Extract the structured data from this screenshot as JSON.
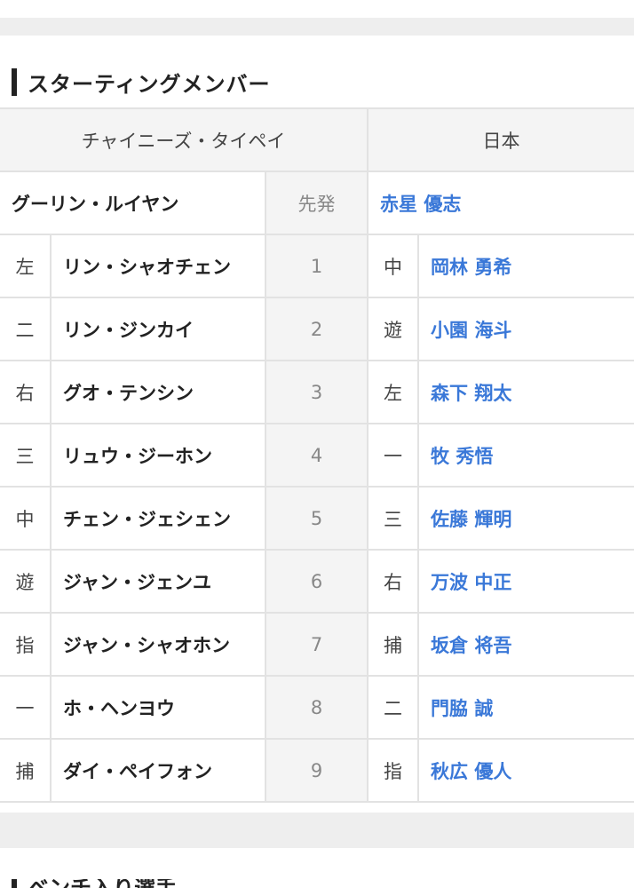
{
  "section": {
    "title": "スターティングメンバー"
  },
  "teams": {
    "away": "チャイニーズ・タイペイ",
    "home": "日本"
  },
  "starter": {
    "label": "先発",
    "away": "グーリン・ルイヤン",
    "home": "赤星 優志"
  },
  "lineup": [
    {
      "order": "1",
      "away_pos": "左",
      "away_name": "リン・シャオチェン",
      "home_pos": "中",
      "home_name": "岡林 勇希"
    },
    {
      "order": "2",
      "away_pos": "二",
      "away_name": "リン・ジンカイ",
      "home_pos": "遊",
      "home_name": "小園 海斗"
    },
    {
      "order": "3",
      "away_pos": "右",
      "away_name": "グオ・テンシン",
      "home_pos": "左",
      "home_name": "森下 翔太"
    },
    {
      "order": "4",
      "away_pos": "三",
      "away_name": "リュウ・ジーホン",
      "home_pos": "一",
      "home_name": "牧 秀悟"
    },
    {
      "order": "5",
      "away_pos": "中",
      "away_name": "チェン・ジェシェン",
      "home_pos": "三",
      "home_name": "佐藤 輝明"
    },
    {
      "order": "6",
      "away_pos": "遊",
      "away_name": "ジャン・ジェンユ",
      "home_pos": "右",
      "home_name": "万波 中正"
    },
    {
      "order": "7",
      "away_pos": "指",
      "away_name": "ジャン・シャオホン",
      "home_pos": "捕",
      "home_name": "坂倉 将吾"
    },
    {
      "order": "8",
      "away_pos": "一",
      "away_name": "ホ・ヘンヨウ",
      "home_pos": "二",
      "home_name": "門脇 誠"
    },
    {
      "order": "9",
      "away_pos": "捕",
      "away_name": "ダイ・ペイフォン",
      "home_pos": "指",
      "home_name": "秋広 優人"
    }
  ],
  "next_section": {
    "title": "ベンチ入り選手"
  },
  "colors": {
    "link": "#3a78d8",
    "header_bg": "#f4f4f4",
    "border": "#e2e2e2"
  }
}
